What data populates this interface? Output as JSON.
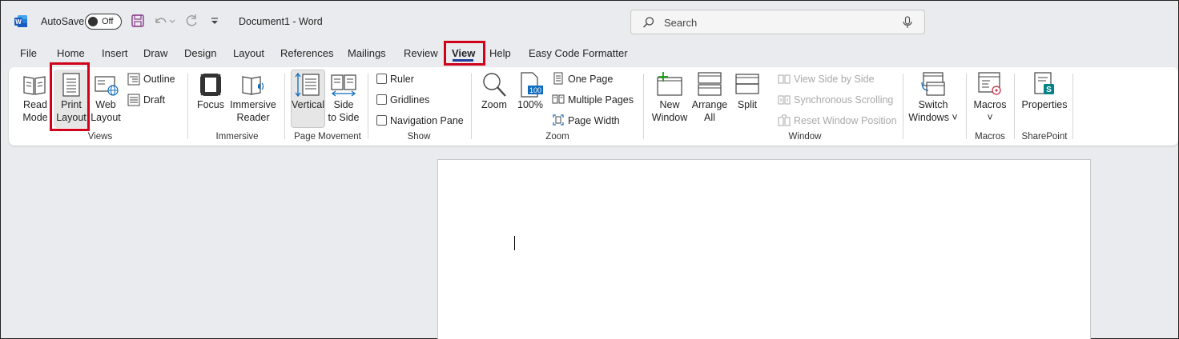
{
  "titlebar": {
    "autosave_label": "AutoSave",
    "autosave_state": "Off",
    "document_title": "Document1  -  Word",
    "search_placeholder": "Search"
  },
  "tabs": [
    {
      "label": "File"
    },
    {
      "label": "Home"
    },
    {
      "label": "Insert"
    },
    {
      "label": "Draw"
    },
    {
      "label": "Design"
    },
    {
      "label": "Layout"
    },
    {
      "label": "References"
    },
    {
      "label": "Mailings"
    },
    {
      "label": "Review"
    },
    {
      "label": "View"
    },
    {
      "label": "Help"
    },
    {
      "label": "Easy Code Formatter"
    }
  ],
  "active_tab": "View",
  "ribbon": {
    "views": {
      "group_label": "Views",
      "read_mode": [
        "Read",
        "Mode"
      ],
      "print_layout": [
        "Print",
        "Layout"
      ],
      "web_layout": [
        "Web",
        "Layout"
      ],
      "outline": "Outline",
      "draft": "Draft"
    },
    "immersive": {
      "group_label": "Immersive",
      "focus": "Focus",
      "immersive_reader": [
        "Immersive",
        "Reader"
      ]
    },
    "page_movement": {
      "group_label": "Page Movement",
      "vertical": "Vertical",
      "side_to_side": [
        "Side",
        "to Side"
      ]
    },
    "show": {
      "group_label": "Show",
      "ruler": "Ruler",
      "gridlines": "Gridlines",
      "navigation_pane": "Navigation Pane"
    },
    "zoom": {
      "group_label": "Zoom",
      "zoom": "Zoom",
      "hundred": "100%",
      "one_page": "One Page",
      "multiple_pages": "Multiple Pages",
      "page_width": "Page Width"
    },
    "window": {
      "group_label": "Window",
      "new_window": [
        "New",
        "Window"
      ],
      "arrange_all": [
        "Arrange",
        "All"
      ],
      "split": "Split",
      "view_side_by_side": "View Side by Side",
      "synchronous_scrolling": "Synchronous Scrolling",
      "reset_window_position": "Reset Window Position",
      "switch_windows": [
        "Switch",
        "Windows ˅"
      ]
    },
    "macros": {
      "group_label": "Macros",
      "macros": "Macros"
    },
    "sharepoint": {
      "group_label": "SharePoint",
      "properties": "Properties"
    }
  },
  "colors": {
    "accent": "#1f3e9a",
    "highlight": "#d0021b",
    "word_blue": "#185abd",
    "sharepoint_green": "#038387",
    "zoom_blue": "#0f6cbd"
  }
}
